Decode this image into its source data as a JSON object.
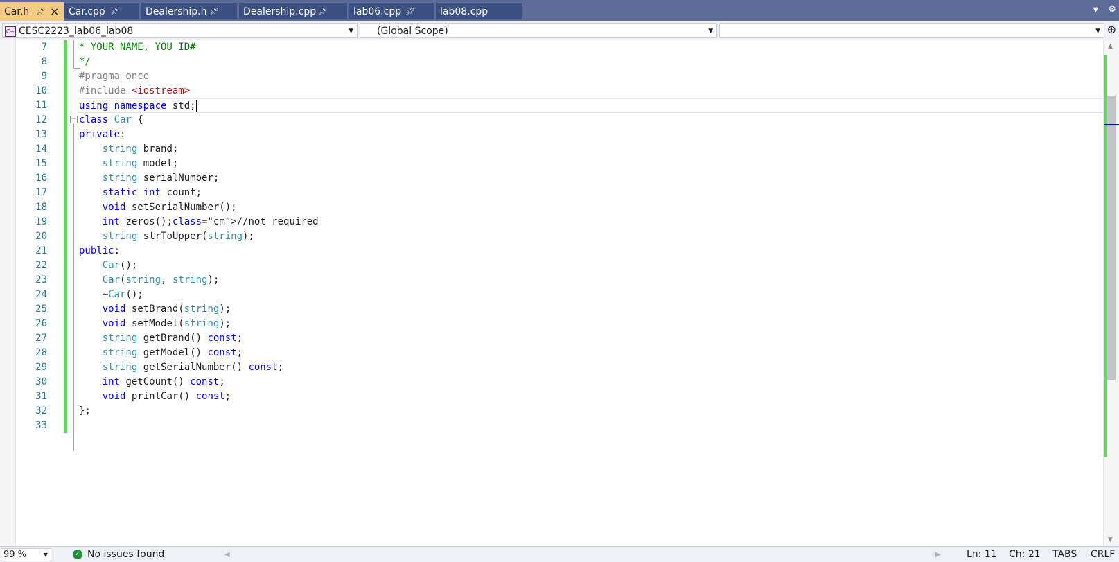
{
  "tabs": [
    {
      "label": "Car.h",
      "pin": "pin-icon",
      "close": "×"
    },
    {
      "label": "Car.cpp",
      "pin": "pin-icon"
    },
    {
      "label": "Dealership.h",
      "pin": "pin-icon"
    },
    {
      "label": "Dealership.cpp",
      "pin": "pin-icon"
    },
    {
      "label": "lab06.cpp",
      "pin": "pin-icon"
    },
    {
      "label": "lab08.cpp"
    }
  ],
  "navbar": {
    "project": "CESC2223_lab06_lab08",
    "scope": "(Global Scope)",
    "member": ""
  },
  "editor": {
    "line_numbers": [
      "7",
      "8",
      "9",
      "10",
      "11",
      "12",
      "13",
      "14",
      "15",
      "16",
      "17",
      "18",
      "19",
      "20",
      "21",
      "22",
      "23",
      "24",
      "25",
      "26",
      "27",
      "28",
      "29",
      "30",
      "31",
      "32",
      "33"
    ],
    "lines": [
      "* YOUR NAME, YOU ID#",
      "*/",
      "#pragma once",
      "#include <iostream>",
      "using namespace std;",
      "class Car {",
      "private:",
      "    string brand;",
      "    string model;",
      "    string serialNumber;",
      "    static int count;",
      "    void setSerialNumber();",
      "    int zeros();//not required",
      "    string strToUpper(string);",
      "public:",
      "    Car();",
      "    Car(string, string);",
      "    ~Car();",
      "    void setBrand(string);",
      "    void setModel(string);",
      "    string getBrand() const;",
      "    string getModel() const;",
      "    string getSerialNumber() const;",
      "    int getCount() const;",
      "    void printCar() const;",
      "};",
      ""
    ],
    "current_line": "11"
  },
  "status": {
    "zoom": "99 %",
    "issues": "No issues found",
    "line": "Ln: 11",
    "char": "Ch: 21",
    "indent": "TABS",
    "eol": "CRLF"
  },
  "colors": {
    "tabbar": "#5d6b99",
    "active_tab": "#f5cc84",
    "keyword": "#0000ff",
    "type": "#2b91af",
    "comment": "#008000",
    "line_number": "#237893",
    "change_bar": "#6ad163"
  }
}
